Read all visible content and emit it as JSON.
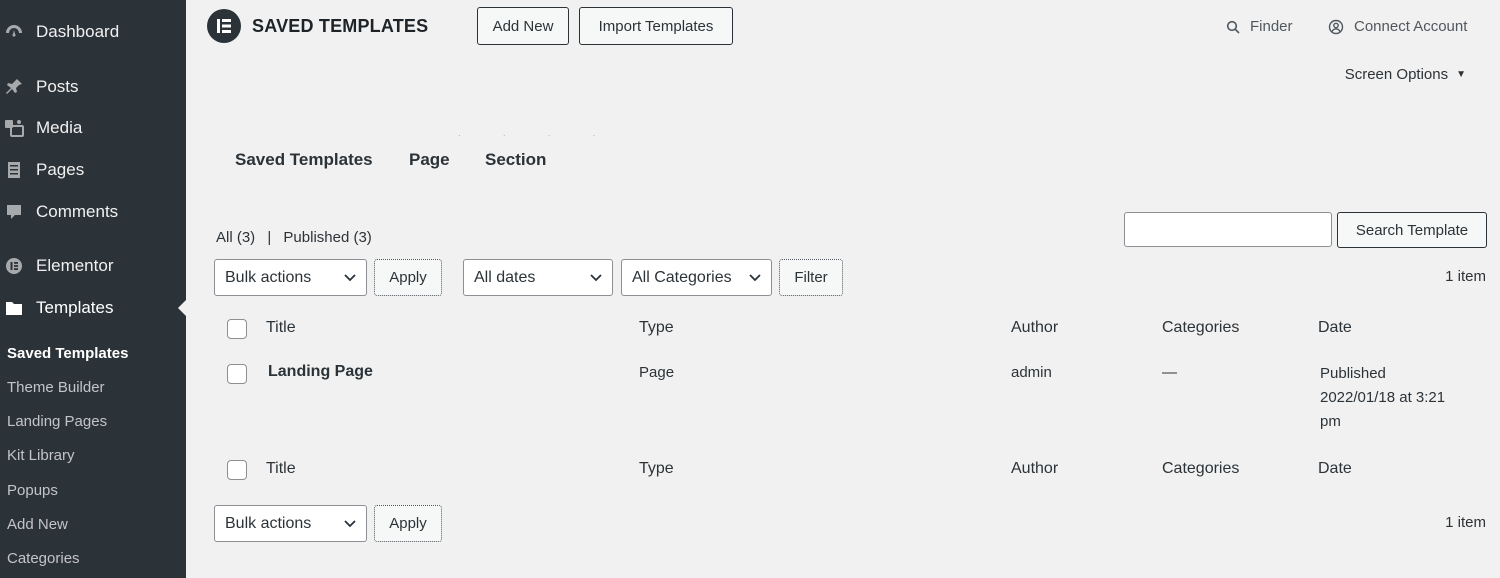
{
  "sidebar": {
    "menu": [
      {
        "label": "Dashboard",
        "icon": "dashboard-icon"
      },
      {
        "label": "Posts",
        "icon": "pin-icon"
      },
      {
        "label": "Media",
        "icon": "media-icon"
      },
      {
        "label": "Pages",
        "icon": "page-icon"
      },
      {
        "label": "Comments",
        "icon": "comment-icon"
      },
      {
        "label": "Elementor",
        "icon": "elementor-icon"
      },
      {
        "label": "Templates",
        "icon": "folder-icon"
      }
    ],
    "submenu": [
      {
        "label": "Saved Templates",
        "active": true
      },
      {
        "label": "Theme Builder"
      },
      {
        "label": "Landing Pages"
      },
      {
        "label": "Kit Library"
      },
      {
        "label": "Popups"
      },
      {
        "label": "Add New"
      },
      {
        "label": "Categories"
      }
    ]
  },
  "header": {
    "title": "SAVED TEMPLATES",
    "add_new": "Add New",
    "import": "Import Templates",
    "finder": "Finder",
    "connect": "Connect Account",
    "screen_options": "Screen Options"
  },
  "tabs": [
    "Saved Templates",
    "Page",
    "Section"
  ],
  "views": {
    "all": "All (3)",
    "separator": "|",
    "published": "Published (3)"
  },
  "search": {
    "button": "Search Template",
    "value": ""
  },
  "filters": {
    "bulk_actions": "Bulk actions",
    "apply": "Apply",
    "dates": "All dates",
    "categories": "All Categories",
    "filter": "Filter",
    "count": "1 item"
  },
  "table": {
    "columns": [
      "Title",
      "Type",
      "Author",
      "Categories",
      "Date"
    ],
    "rows": [
      {
        "title": "Landing Page",
        "type": "Page",
        "author": "admin",
        "categories": "—",
        "date_status": "Published",
        "date_value": "2022/01/18 at 3:21 pm"
      }
    ]
  },
  "footer_filters": {
    "bulk_actions": "Bulk actions",
    "apply": "Apply",
    "count": "1 item"
  },
  "colors": {
    "sidebar": "#2c3338",
    "background": "#f1f1f1",
    "text": "#2c3338"
  }
}
